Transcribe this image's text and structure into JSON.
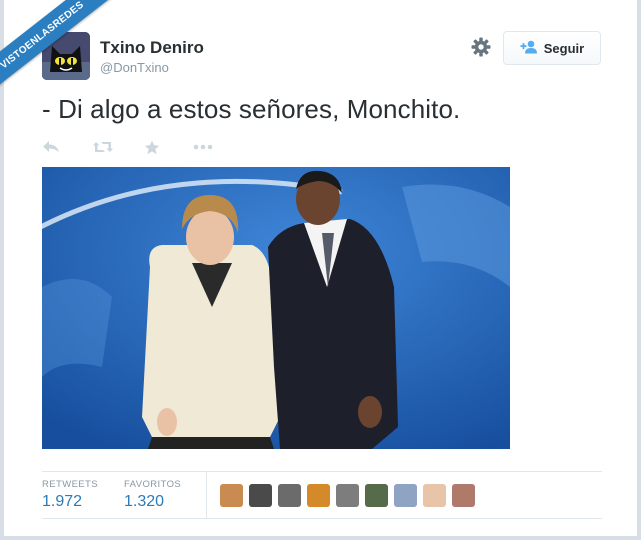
{
  "watermark": "VISTOENLASREDES",
  "user": {
    "name": "Txino Deniro",
    "handle": "@DonTxino"
  },
  "follow_label": "Seguir",
  "tweet": {
    "text": "- Di algo a estos señores, Monchito."
  },
  "stats": {
    "retweets_label": "RETWEETS",
    "retweets_value": "1.972",
    "favorites_label": "FAVORITOS",
    "favorites_value": "1.320"
  },
  "icons": {
    "settings": "gear-icon",
    "follow": "add-user-icon",
    "reply": "reply-icon",
    "retweet": "retweet-icon",
    "favorite": "star-icon",
    "more": "more-icon"
  },
  "colors": {
    "accent": "#2b7bb9",
    "banner": "#2b7fc1",
    "muted": "#8899a6",
    "text": "#292f33"
  },
  "favoriters_avatar_colors": [
    "#c98b52",
    "#4a4a4a",
    "#6b6b6b",
    "#d58a2a",
    "#7d7d7d",
    "#556b4a",
    "#8fa3c2",
    "#e8c4a8",
    "#b07a6a"
  ]
}
